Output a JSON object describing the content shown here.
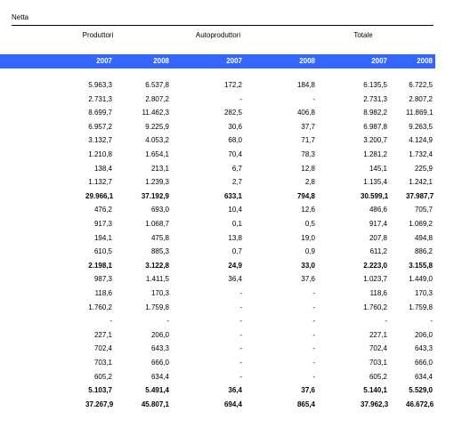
{
  "title": "Netta",
  "groups": [
    "Produttori",
    "Autoproduttori",
    "Totale"
  ],
  "years": [
    "2007",
    "2008",
    "2007",
    "2008",
    "2007",
    "2008"
  ],
  "rows": [
    {
      "bold": false,
      "v": [
        "5.963,3",
        "6.537,8",
        "172,2",
        "184,8",
        "6.135,5",
        "6.722,5"
      ]
    },
    {
      "bold": false,
      "v": [
        "2.731,3",
        "2.807,2",
        "-",
        "-",
        "2.731,3",
        "2.807,2"
      ]
    },
    {
      "bold": false,
      "v": [
        "8.699,7",
        "11.462,3",
        "282,5",
        "406,8",
        "8.982,2",
        "11.869,1"
      ]
    },
    {
      "bold": false,
      "v": [
        "6.957,2",
        "9.225,9",
        "30,6",
        "37,7",
        "6.987,8",
        "9.263,5"
      ]
    },
    {
      "bold": false,
      "v": [
        "3.132,7",
        "4.053,2",
        "68,0",
        "71,7",
        "3.200,7",
        "4.124,9"
      ]
    },
    {
      "bold": false,
      "v": [
        "1.210,8",
        "1.654,1",
        "70,4",
        "78,3",
        "1.281,2",
        "1.732,4"
      ]
    },
    {
      "bold": false,
      "v": [
        "138,4",
        "213,1",
        "6,7",
        "12,8",
        "145,1",
        "225,9"
      ]
    },
    {
      "bold": false,
      "v": [
        "1.132,7",
        "1.239,3",
        "2,7",
        "2,8",
        "1.135,4",
        "1.242,1"
      ]
    },
    {
      "bold": true,
      "v": [
        "29.966,1",
        "37.192,9",
        "633,1",
        "794,8",
        "30.599,1",
        "37.987,7"
      ]
    },
    {
      "bold": false,
      "v": [
        "476,2",
        "693,0",
        "10,4",
        "12,6",
        "486,6",
        "705,7"
      ]
    },
    {
      "bold": false,
      "v": [
        "917,3",
        "1.068,7",
        "0,1",
        "0,5",
        "917,4",
        "1.069,2"
      ]
    },
    {
      "bold": false,
      "v": [
        "194,1",
        "475,8",
        "13,8",
        "19,0",
        "207,8",
        "494,8"
      ]
    },
    {
      "bold": false,
      "v": [
        "610,5",
        "885,3",
        "0,7",
        "0,9",
        "611,2",
        "886,2"
      ]
    },
    {
      "bold": true,
      "v": [
        "2.198,1",
        "3.122,8",
        "24,9",
        "33,0",
        "2.223,0",
        "3.155,8"
      ]
    },
    {
      "bold": false,
      "v": [
        "987,3",
        "1.411,5",
        "36,4",
        "37,6",
        "1.023,7",
        "1.449,0"
      ]
    },
    {
      "bold": false,
      "v": [
        "118,6",
        "170,3",
        "-",
        "-",
        "118,6",
        "170,3"
      ]
    },
    {
      "bold": false,
      "v": [
        "1.760,2",
        "1.759,8",
        "-",
        "-",
        "1.760,2",
        "1.759,8"
      ]
    },
    {
      "bold": false,
      "v": [
        "-",
        "-",
        "-",
        "-",
        "-",
        "-"
      ]
    },
    {
      "bold": false,
      "v": [
        "227,1",
        "206,0",
        "-",
        "-",
        "227,1",
        "206,0"
      ]
    },
    {
      "bold": false,
      "v": [
        "702,4",
        "643,3",
        "-",
        "-",
        "702,4",
        "643,3"
      ]
    },
    {
      "bold": false,
      "v": [
        "703,1",
        "666,0",
        "-",
        "-",
        "703,1",
        "666,0"
      ]
    },
    {
      "bold": false,
      "v": [
        "605,2",
        "634,4",
        "-",
        "-",
        "605,2",
        "634,4"
      ]
    },
    {
      "bold": true,
      "v": [
        "5.103,7",
        "5.491,4",
        "36,4",
        "37,6",
        "5.140,1",
        "5.529,0"
      ]
    },
    {
      "bold": true,
      "v": [
        "37.267,9",
        "45.807,1",
        "694,4",
        "865,4",
        "37.962,3",
        "46.672,6"
      ]
    }
  ]
}
